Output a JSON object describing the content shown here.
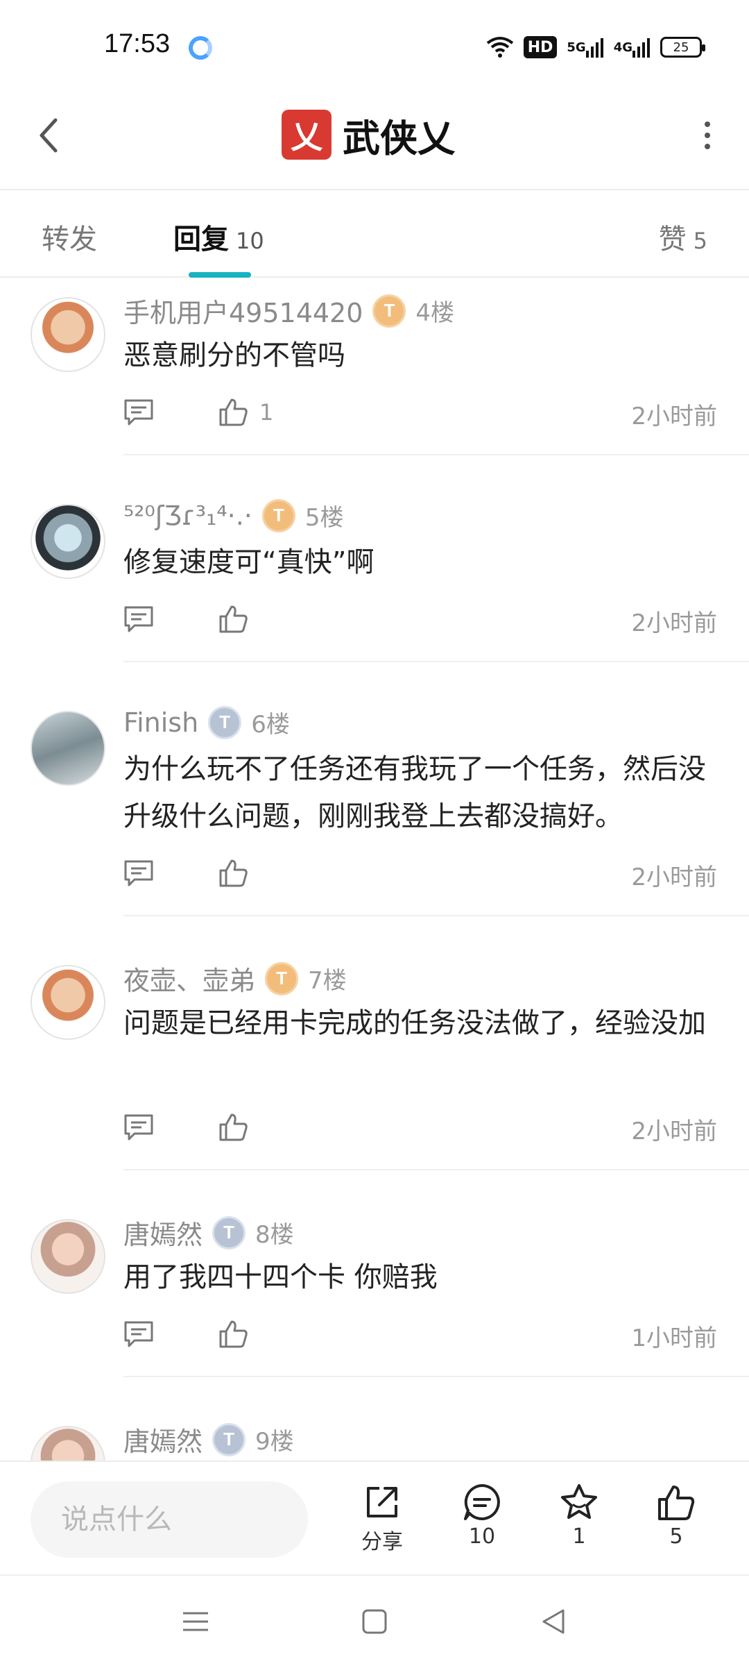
{
  "status": {
    "time": "17:53",
    "hd": "HD",
    "net1": "5G",
    "net2": "4G",
    "battery": "25"
  },
  "header": {
    "title": "武侠乂",
    "logo_char": "乂"
  },
  "tabs": {
    "forward": "转发",
    "reply": "回复",
    "reply_count": "10",
    "like": "赞",
    "like_count": "5"
  },
  "comments": [
    {
      "user": "手机用户49514420",
      "badge": "T",
      "floor": "4楼",
      "text": "恶意刷分的不管吗",
      "likes": "1",
      "time": "2小时前"
    },
    {
      "user": "⁵²⁰ʃƷɾ³₁⁴·.·",
      "badge": "T",
      "floor": "5楼",
      "text": "修复速度可“真快”啊",
      "likes": "",
      "time": "2小时前"
    },
    {
      "user": "Finish",
      "badge": "T",
      "floor": "6楼",
      "text": "为什么玩不了任务还有我玩了一个任务，然后没升级什么问题，刚刚我登上去都没搞好。",
      "likes": "",
      "time": "2小时前"
    },
    {
      "user": "夜壶、壶弟",
      "badge": "T",
      "floor": "7楼",
      "text": "问题是已经用卡完成的任务没法做了，经验没加",
      "likes": "",
      "time": "2小时前"
    },
    {
      "user": "唐嫣然",
      "badge": "T",
      "floor": "8楼",
      "text": "用了我四十四个卡 你赔我",
      "likes": "",
      "time": "1小时前"
    },
    {
      "user": "唐嫣然",
      "badge": "T",
      "floor": "9楼",
      "text": "",
      "likes": "",
      "time": ""
    }
  ],
  "bottom": {
    "input_placeholder": "说点什么",
    "share_label": "分享",
    "comment_count": "10",
    "star_count": "1",
    "like_count": "5"
  },
  "colors": {
    "accent": "#17b3c1",
    "logo_red": "#d83a32"
  }
}
